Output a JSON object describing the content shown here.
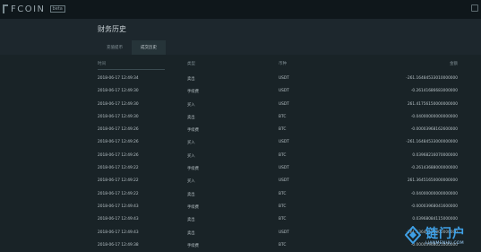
{
  "app": {
    "logo_text": "FCOIN",
    "logo_badge": "beta"
  },
  "page": {
    "title": "财务历史"
  },
  "tabs": [
    {
      "label": "充值提币"
    },
    {
      "label": "成交历史"
    }
  ],
  "table": {
    "headers": {
      "time": "时间",
      "type": "类型",
      "coin": "币种",
      "amount": "金额"
    },
    "rows": [
      {
        "time": "2018-06-17 12:49:34",
        "type": "卖出",
        "coin": "USDT",
        "amount": "-261.16484533010000000"
      },
      {
        "time": "2018-06-17 12:49:30",
        "type": "手续费",
        "coin": "USDT",
        "amount": "-0.26141686683000000"
      },
      {
        "time": "2018-06-17 12:49:30",
        "type": "买入",
        "coin": "USDT",
        "amount": "261.41756150000000000"
      },
      {
        "time": "2018-06-17 12:49:30",
        "type": "卖出",
        "coin": "BTC",
        "amount": "-0.04000000000000000"
      },
      {
        "time": "2018-06-17 12:49:26",
        "type": "手续费",
        "coin": "BTC",
        "amount": "-0.00003968162600000"
      },
      {
        "time": "2018-06-17 12:49:26",
        "type": "买入",
        "coin": "USDT",
        "amount": "-261.16484533000000000"
      },
      {
        "time": "2018-06-17 12:49:26",
        "type": "买入",
        "coin": "BTC",
        "amount": "0.03968216070000000"
      },
      {
        "time": "2018-06-17 12:49:22",
        "type": "手续费",
        "coin": "USDT",
        "amount": "-0.26143688000000000"
      },
      {
        "time": "2018-06-17 12:49:22",
        "type": "买入",
        "coin": "USDT",
        "amount": "261.36451650000000000"
      },
      {
        "time": "2018-06-17 12:49:22",
        "type": "卖出",
        "coin": "BTC",
        "amount": "-0.04000000000000000"
      },
      {
        "time": "2018-06-17 12:49:43",
        "type": "手续费",
        "coin": "BTC",
        "amount": "-0.00003968041600000"
      },
      {
        "time": "2018-06-17 12:49:43",
        "type": "卖出",
        "coin": "BTC",
        "amount": "0.03968084115000000"
      },
      {
        "time": "2018-06-17 12:49:43",
        "type": "卖出",
        "coin": "USDT",
        "amount": "-261.13640120000000000"
      },
      {
        "time": "2018-06-17 12:49:38",
        "type": "手续费",
        "coin": "BTC",
        "amount": "-0.00003968021000000"
      }
    ]
  },
  "watermark": {
    "title": "链门户",
    "url": "LIANMENHU.COM"
  },
  "icons": {
    "logo": "fcoin-logo-icon",
    "top_right": "window-icon",
    "watermark": "chain-logo-icon"
  }
}
